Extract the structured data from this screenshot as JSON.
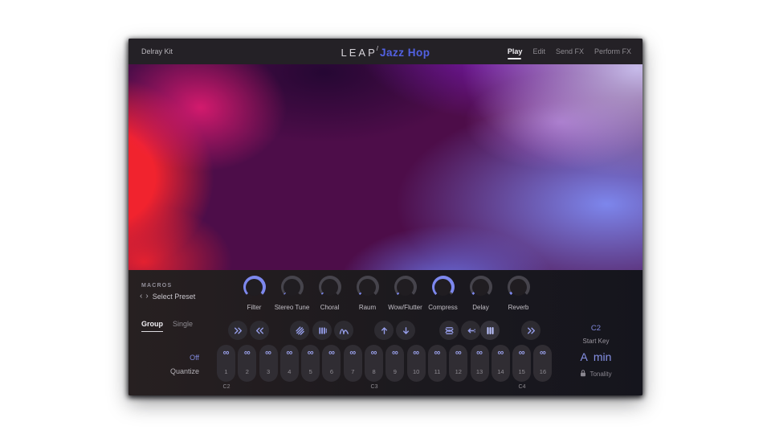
{
  "header": {
    "kit_name": "Delray Kit",
    "logo": {
      "brand": "LEAP",
      "separator": "/",
      "product": "Jazz Hop"
    },
    "tabs": [
      {
        "label": "Play",
        "active": true
      },
      {
        "label": "Edit",
        "active": false
      },
      {
        "label": "Send FX",
        "active": false
      },
      {
        "label": "Perform FX",
        "active": false
      }
    ]
  },
  "macros": {
    "section_label": "MACROS",
    "preset_prev": "‹",
    "preset_next": "›",
    "preset_name": "Select Preset",
    "knobs": [
      {
        "label": "Filter",
        "value": 1.0
      },
      {
        "label": "Stereo Tune",
        "value": 0.02
      },
      {
        "label": "Choral",
        "value": 0.03
      },
      {
        "label": "Raum",
        "value": 0.03
      },
      {
        "label": "Wow/Flutter",
        "value": 0.03
      },
      {
        "label": "Compress",
        "value": 0.97
      },
      {
        "label": "Delay",
        "value": 0.04
      },
      {
        "label": "Reverb",
        "value": 0.05
      }
    ]
  },
  "group_tabs": [
    {
      "label": "Group",
      "active": true
    },
    {
      "label": "Single",
      "active": false
    }
  ],
  "toolbar": {
    "buttons": [
      {
        "name": "shift-right",
        "icon": "chevrons-right",
        "active": false
      },
      {
        "name": "shift-left",
        "icon": "chevrons-left",
        "active": false
      },
      {
        "name": "layers",
        "icon": "layers",
        "active": false
      },
      {
        "name": "pattern-bars",
        "icon": "bars",
        "active": false
      },
      {
        "name": "envelope-curves",
        "icon": "curves",
        "active": false
      },
      {
        "name": "transpose-up",
        "icon": "arrow-up",
        "active": false
      },
      {
        "name": "transpose-down",
        "icon": "arrow-down",
        "active": false
      },
      {
        "name": "stretch",
        "icon": "stretch",
        "active": false
      },
      {
        "name": "nudge-left",
        "icon": "nudge-left",
        "active": false
      },
      {
        "name": "grid-bars",
        "icon": "grid-bars",
        "active": true
      },
      {
        "name": "advance",
        "icon": "chevrons-right",
        "active": false
      }
    ]
  },
  "quantize": {
    "value": "Off",
    "label": "Quantize"
  },
  "pads": {
    "glyph": "∞",
    "numbers": [
      "1",
      "2",
      "3",
      "4",
      "5",
      "6",
      "7",
      "8",
      "9",
      "10",
      "11",
      "12",
      "13",
      "14",
      "15",
      "16"
    ],
    "octaves": [
      {
        "label": "C2"
      },
      {
        "label": "C3"
      },
      {
        "label": "C4"
      }
    ]
  },
  "key": {
    "start_key_value": "C2",
    "start_key_label": "Start Key",
    "tonality_root": "A",
    "tonality_scale": "min",
    "tonality_label": "Tonality"
  },
  "colors": {
    "accent_periwinkle": "#7d88ee",
    "logo_blue": "#5261e2",
    "panel_dark": "#1b181c",
    "art_red": "#f1232e",
    "art_magenta": "#e51c72",
    "art_purple": "#4d0d49",
    "art_violet": "#7a1ab6",
    "art_lavender": "#cdc4f2"
  }
}
